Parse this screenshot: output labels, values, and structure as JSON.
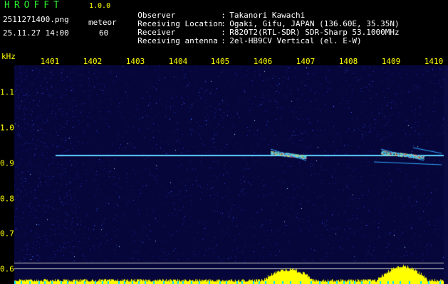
{
  "header": {
    "app_title": "HROFFT",
    "app_version": "1.0.0",
    "filename": "2511271400.png",
    "datetime": "25.11.27 14:00",
    "mode_label": "meteor",
    "mode_count": "60"
  },
  "info": [
    {
      "label": "Observer",
      "value": "Takanori Kawachi"
    },
    {
      "label": "Receiving Location",
      "value": "Ogaki, Gifu, JAPAN (136.60E, 35.35N)"
    },
    {
      "label": "Receiver",
      "value": "R820T2(RTL-SDR) SDR-Sharp 53.1000MHz"
    },
    {
      "label": "Receiving antenna",
      "value": "2el-HB9CV Vertical (el. E-W)"
    }
  ],
  "axes": {
    "y_unit": "kHz",
    "x_ticks": [
      "1401",
      "1402",
      "1403",
      "1404",
      "1405",
      "1406",
      "1407",
      "1408",
      "1409",
      "1410"
    ],
    "y_ticks": [
      "1.1",
      "1.0",
      "0.9",
      "0.8",
      "0.7",
      "0.6"
    ],
    "colon": ":"
  },
  "colors": {
    "background": "#000000",
    "noise": "#1a1a8c",
    "carrier": "#4fd6ff",
    "meteor_hot": "#ff3060",
    "bottom_fill": "#ffff00"
  }
}
